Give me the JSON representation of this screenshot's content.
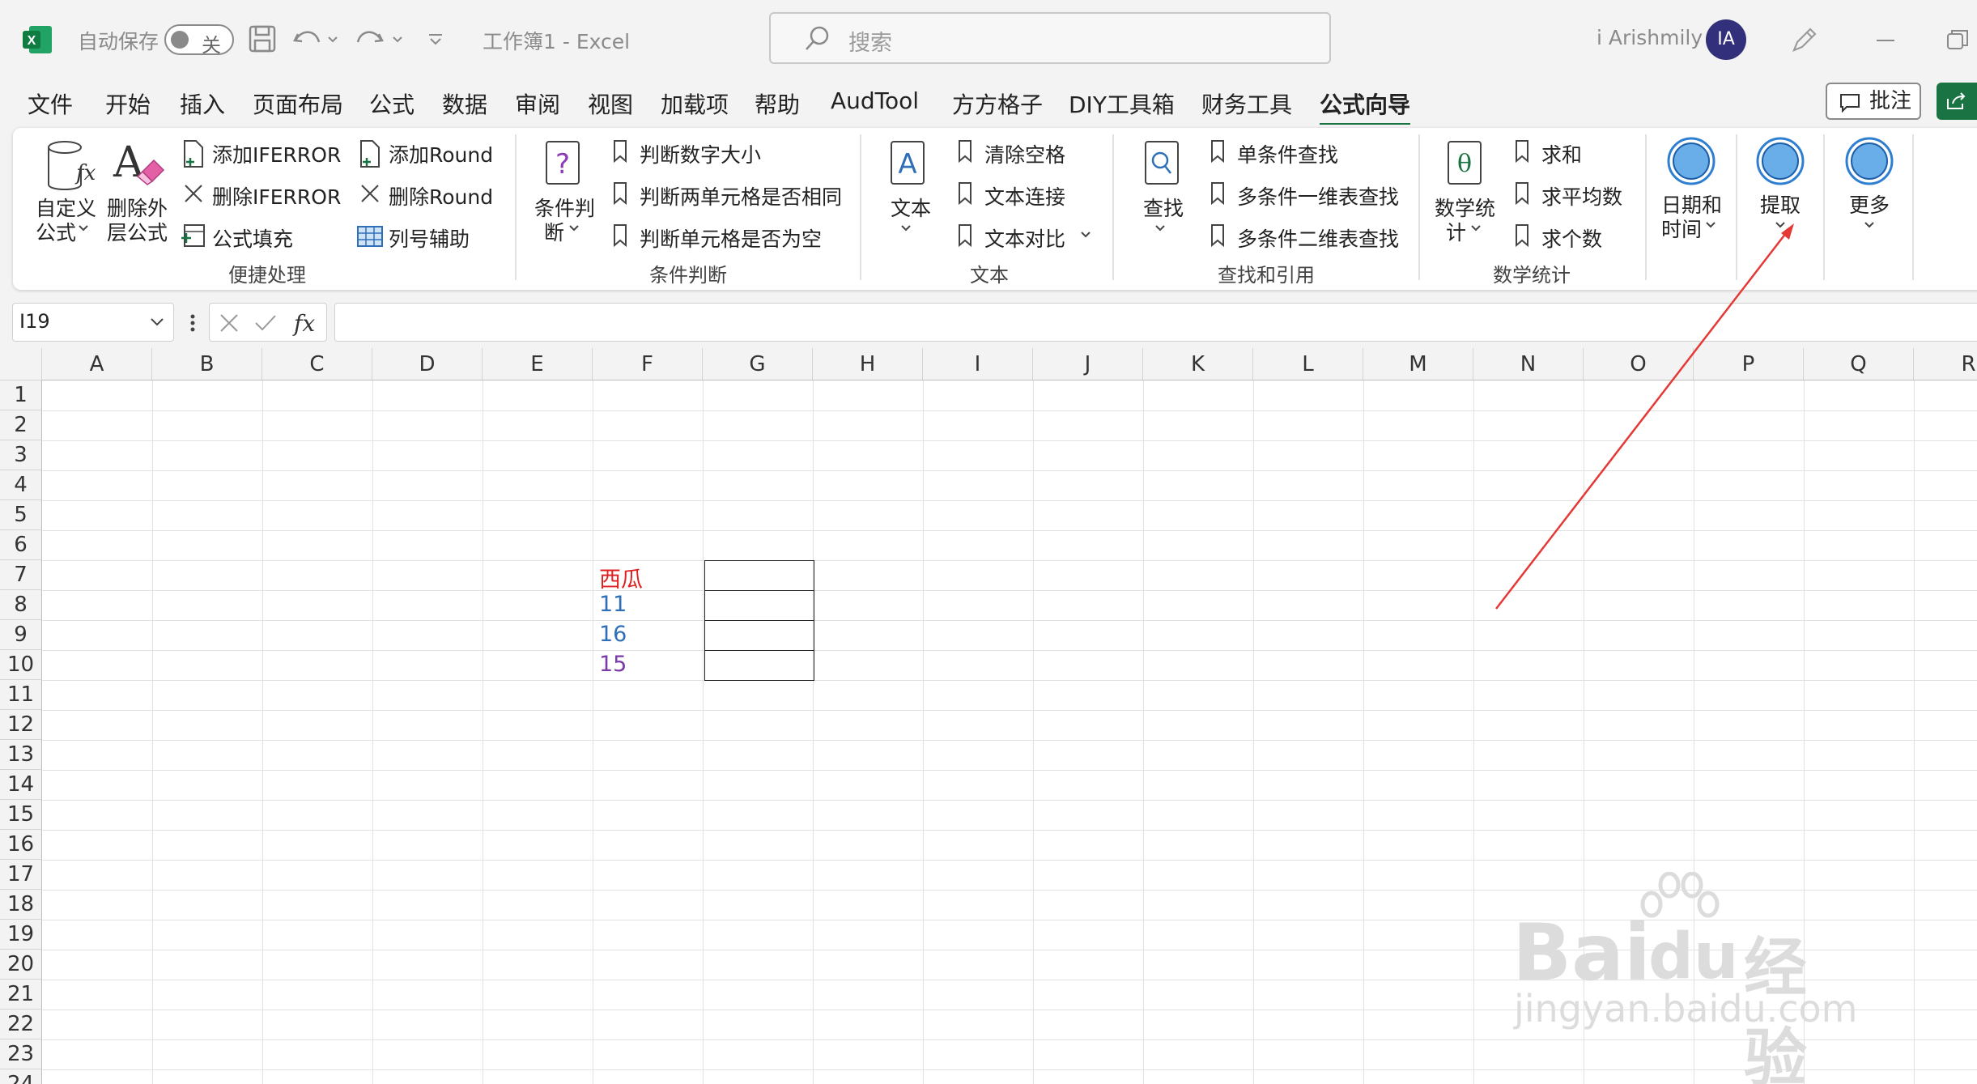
{
  "titlebar": {
    "autosave_label": "自动保存",
    "autosave_state": "关",
    "workbook_title": "工作簿1  -  Excel",
    "search_placeholder": "搜索",
    "user_name": "i Arishmily",
    "avatar_initials": "IA"
  },
  "menu": {
    "tabs": [
      "文件",
      "开始",
      "插入",
      "页面布局",
      "公式",
      "数据",
      "审阅",
      "视图",
      "加载项",
      "帮助",
      "AudTool",
      "方方格子",
      "DIY工具箱",
      "财务工具",
      "公式向导"
    ],
    "active_tab": "公式向导",
    "comment_button": "批注"
  },
  "ribbon": {
    "quick": {
      "custom_formula": "自定义",
      "custom_formula2": "公式",
      "delete_outer": "删除外",
      "delete_outer2": "层公式",
      "add_iferror": "添加IFERROR",
      "del_iferror": "删除IFERROR",
      "formula_fill": "公式填充",
      "add_round": "添加Round",
      "del_round": "删除Round",
      "col_assist": "列号辅助",
      "group_label": "便捷处理"
    },
    "cond": {
      "big_label1": "条件判",
      "big_label2": "断",
      "item1": "判断数字大小",
      "item2": "判断两单元格是否相同",
      "item3": "判断单元格是否为空",
      "group_label": "条件判断"
    },
    "text": {
      "big_label": "文本",
      "item1": "清除空格",
      "item2": "文本连接",
      "item3": "文本对比",
      "group_label": "文本"
    },
    "lookup": {
      "big_label": "查找",
      "item1": "单条件查找",
      "item2": "多条件一维表查找",
      "item3": "多条件二维表查找",
      "group_label": "查找和引用"
    },
    "math": {
      "big_label1": "数学统",
      "big_label2": "计",
      "item1": "求和",
      "item2": "求平均数",
      "item3": "求个数",
      "group_label": "数学统计"
    },
    "date": {
      "label1": "日期和",
      "label2": "时间"
    },
    "extract": {
      "label": "提取"
    },
    "more": {
      "label": "更多"
    }
  },
  "formula_bar": {
    "name_box": "I19",
    "formula": ""
  },
  "sheet": {
    "columns": [
      "A",
      "B",
      "C",
      "D",
      "E",
      "F",
      "G",
      "H",
      "I",
      "J",
      "K",
      "L",
      "M",
      "N",
      "O",
      "P",
      "Q",
      "R"
    ],
    "rows": [
      "1",
      "2",
      "3",
      "4",
      "5",
      "6",
      "7",
      "8",
      "9",
      "10",
      "11",
      "12",
      "13",
      "14",
      "15",
      "16",
      "17",
      "18",
      "19",
      "20",
      "21",
      "22",
      "23",
      "24"
    ],
    "cells": {
      "F7": {
        "value": "西瓜",
        "color": "#e02020"
      },
      "F8": {
        "value": "11",
        "color": "#2f6fb8"
      },
      "F9": {
        "value": "16",
        "color": "#2f6fb8"
      },
      "F10": {
        "value": "15",
        "color": "#7a3aa8"
      }
    }
  },
  "annotation": {
    "arrow_color": "#e53935"
  },
  "watermark": {
    "brand": "Bai",
    "brand2": "du",
    "suffix": "经验",
    "url": "jingyan.baidu.com"
  }
}
